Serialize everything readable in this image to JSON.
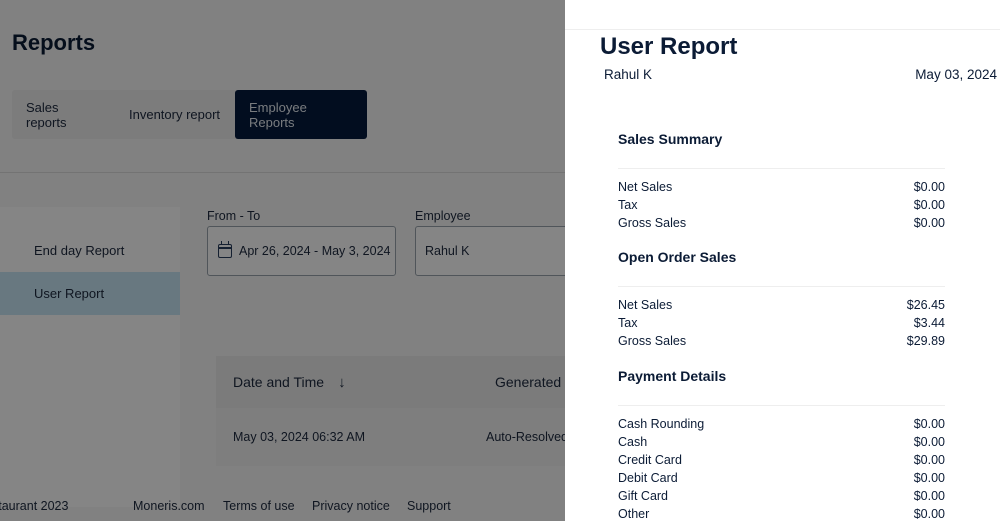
{
  "page": {
    "title": "Reports",
    "tabs": [
      {
        "label": "Sales reports",
        "active": false
      },
      {
        "label": "Inventory report",
        "active": false
      },
      {
        "label": "Employee Reports",
        "active": true
      }
    ],
    "sidenav": [
      {
        "label": "End day Report",
        "active": false
      },
      {
        "label": "User Report",
        "active": true
      }
    ],
    "filters": {
      "date_label": "From - To",
      "date_value": "Apr 26, 2024 - May 3, 2024",
      "employee_label": "Employee",
      "employee_value": "Rahul K"
    },
    "table": {
      "columns": [
        "Date and Time",
        "Generated"
      ],
      "sort_icon": "arrow-down-icon",
      "rows": [
        {
          "date_time": "May 03, 2024 06:32 AM",
          "generated": "Auto-Resolved"
        }
      ]
    },
    "footer": {
      "copyright": "staurant 2023",
      "links": [
        "Moneris.com",
        "Terms of use",
        "Privacy notice",
        "Support"
      ]
    }
  },
  "drawer": {
    "title": "User Report",
    "employee": "Rahul K",
    "date": "May 03, 2024",
    "sections": [
      {
        "title": "Sales Summary",
        "rows": [
          {
            "label": "Net Sales",
            "value": "$0.00"
          },
          {
            "label": "Tax",
            "value": "$0.00"
          },
          {
            "label": "Gross Sales",
            "value": "$0.00"
          }
        ]
      },
      {
        "title": "Open Order Sales",
        "rows": [
          {
            "label": "Net Sales",
            "value": "$26.45"
          },
          {
            "label": "Tax",
            "value": "$3.44"
          },
          {
            "label": "Gross Sales",
            "value": "$29.89"
          }
        ]
      },
      {
        "title": "Payment Details",
        "rows": [
          {
            "label": "Cash Rounding",
            "value": "$0.00"
          },
          {
            "label": "Cash",
            "value": "$0.00"
          },
          {
            "label": "Credit Card",
            "value": "$0.00"
          },
          {
            "label": "Debit Card",
            "value": "$0.00"
          },
          {
            "label": "Gift Card",
            "value": "$0.00"
          },
          {
            "label": "Other",
            "value": "$0.00"
          }
        ]
      }
    ]
  }
}
